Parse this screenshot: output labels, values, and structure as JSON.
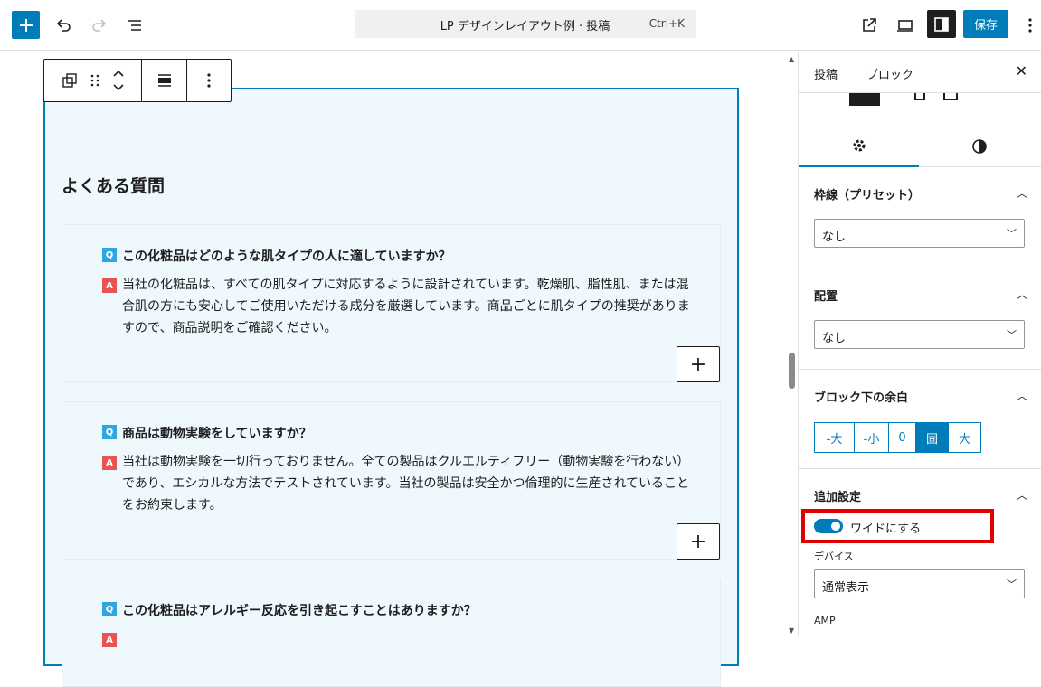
{
  "topbar": {
    "command_title": "LP デザインレイアウト例 · 投稿",
    "command_shortcut": "Ctrl+K",
    "save_label": "保存"
  },
  "faq": {
    "heading": "よくある質問",
    "items": [
      {
        "q_badge": "Q",
        "question": "この化粧品はどのような肌タイプの人に適していますか？",
        "a_badge": "A",
        "answer": "当社の化粧品は、すべての肌タイプに対応するように設計されています。乾燥肌、脂性肌、または混合肌の方にも安心してご使用いただける成分を厳選しています。商品ごとに肌タイプの推奨がありますので、商品説明をご確認ください。",
        "plus": "+"
      },
      {
        "q_badge": "Q",
        "question": "商品は動物実験をしていますか？",
        "a_badge": "A",
        "answer": "当社は動物実験を一切行っておりません。全ての製品はクルエルティフリー（動物実験を行わない）であり、エシカルな方法でテストされています。当社の製品は安全かつ倫理的に生産されていることをお約束します。",
        "plus": "+"
      },
      {
        "q_badge": "Q",
        "question": "この化粧品はアレルギー反応を引き起こすことはありますか？",
        "a_badge": "A",
        "answer": "",
        "plus": "+"
      }
    ]
  },
  "panel": {
    "tab_post": "投稿",
    "tab_block": "ブロック",
    "close": "✕",
    "sections": {
      "border_preset": {
        "title": "枠線（プリセット）",
        "value": "なし"
      },
      "align": {
        "title": "配置",
        "value": "なし"
      },
      "margin_bottom": {
        "title": "ブロック下の余白",
        "options": [
          "-大",
          "-小",
          "0",
          "固",
          "大"
        ],
        "selected": "固"
      },
      "extra": {
        "title": "追加設定",
        "toggle_label": "ワイドにする",
        "device_label": "デバイス",
        "device_value": "通常表示",
        "amp_label": "AMP"
      }
    }
  },
  "colors": {
    "accent": "#007cba",
    "highlight": "#e00000",
    "q_badge": "#2ea7e0",
    "a_badge": "#e85451"
  }
}
